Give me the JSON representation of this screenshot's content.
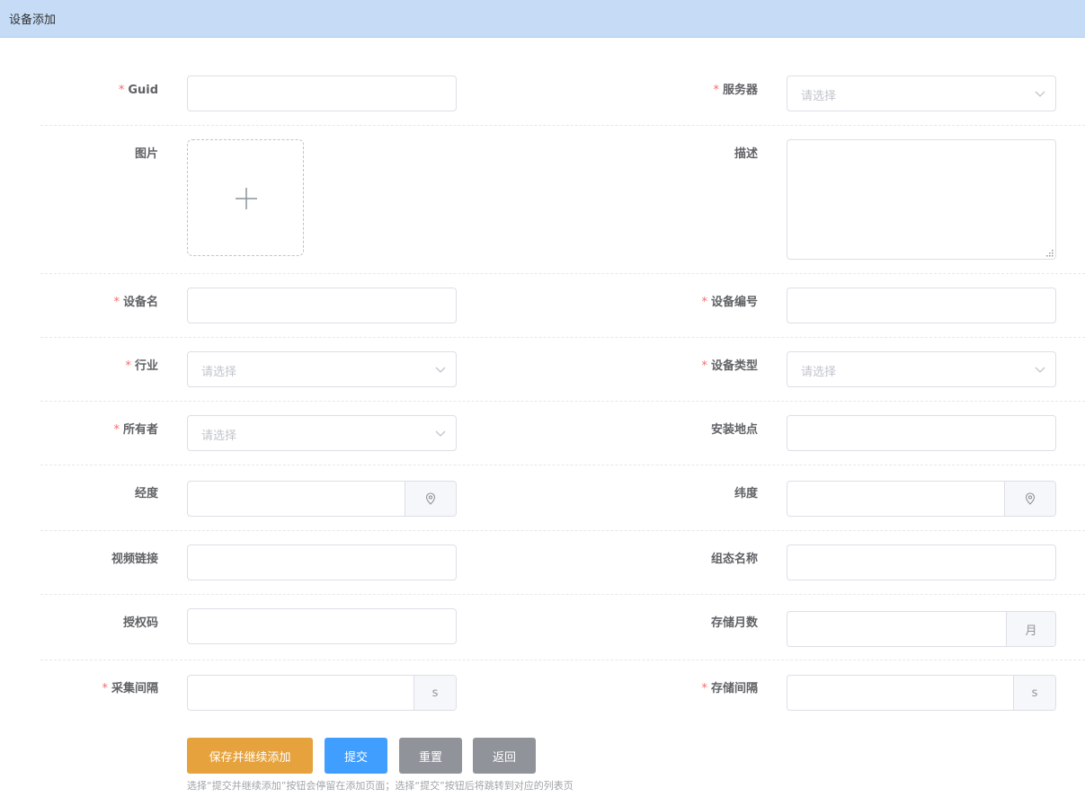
{
  "header": {
    "title": "设备添加"
  },
  "required_mark": "*",
  "fields": {
    "guid": {
      "label": "Guid",
      "value": ""
    },
    "server": {
      "label": "服务器",
      "placeholder": "请选择"
    },
    "image": {
      "label": "图片"
    },
    "description": {
      "label": "描述",
      "value": ""
    },
    "device_name": {
      "label": "设备名",
      "value": ""
    },
    "device_number": {
      "label": "设备编号",
      "value": ""
    },
    "industry": {
      "label": "行业",
      "placeholder": "请选择"
    },
    "device_type": {
      "label": "设备类型",
      "placeholder": "请选择"
    },
    "owner": {
      "label": "所有者",
      "placeholder": "请选择"
    },
    "install_location": {
      "label": "安装地点",
      "value": ""
    },
    "longitude": {
      "label": "经度",
      "value": ""
    },
    "latitude": {
      "label": "纬度",
      "value": ""
    },
    "video_link": {
      "label": "视频链接",
      "value": ""
    },
    "config_name": {
      "label": "组态名称",
      "value": ""
    },
    "auth_code": {
      "label": "授权码",
      "value": ""
    },
    "storage_months": {
      "label": "存储月数",
      "value": "",
      "unit": "月"
    },
    "collect_interval": {
      "label": "采集间隔",
      "value": "",
      "unit": "s"
    },
    "storage_interval": {
      "label": "存储间隔",
      "value": "",
      "unit": "s"
    }
  },
  "buttons": {
    "save_continue": "保存并继续添加",
    "submit": "提交",
    "reset": "重置",
    "back": "返回"
  },
  "hint": "选择“提交并继续添加”按钮会停留在添加页面；选择“提交”按钮后将跳转到对应的列表页",
  "colors": {
    "header_bg": "#c6dcf6",
    "required": "#f56c6c",
    "save_button": "#e6a23c",
    "submit_button": "#409eff",
    "neutral_button": "#909399"
  }
}
